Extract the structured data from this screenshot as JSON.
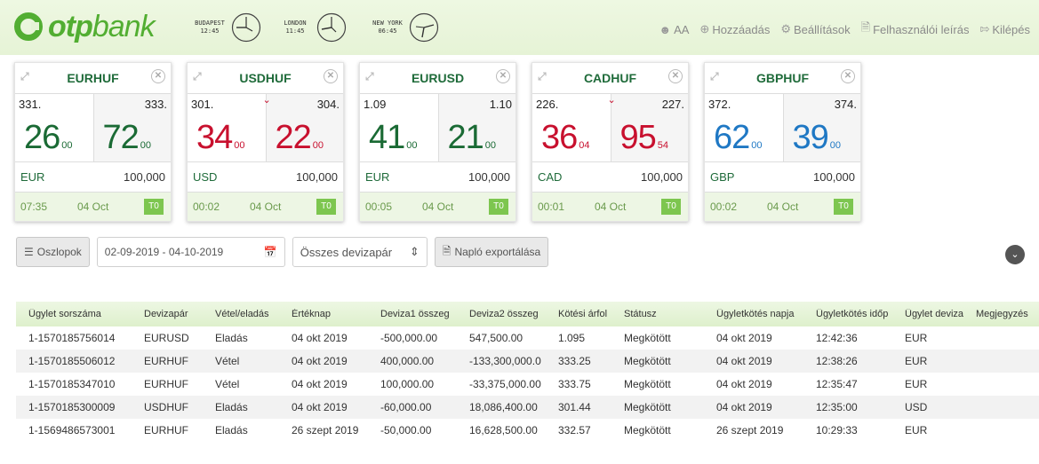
{
  "brand": {
    "otp": "otp",
    "bank": "bank"
  },
  "clocks": [
    {
      "city": "BUDAPEST",
      "time": "12:45"
    },
    {
      "city": "LONDON",
      "time": "11:45"
    },
    {
      "city": "NEW YORK",
      "time": "06:45"
    }
  ],
  "nav": [
    {
      "label": "AA",
      "icon": "user-icon"
    },
    {
      "label": "Hozzáadás",
      "icon": "plus-circle-icon"
    },
    {
      "label": "Beállítások",
      "icon": "gear-icon"
    },
    {
      "label": "Felhasználói leírás",
      "icon": "document-icon"
    },
    {
      "label": "Kilépés",
      "icon": "logout-icon"
    }
  ],
  "tiles": [
    {
      "pair": "EURHUF",
      "sell_small": "331.",
      "sell_big": "26",
      "sell_sub": "00",
      "buy_small": "333.",
      "buy_big": "72",
      "buy_sub": "00",
      "ccy": "EUR",
      "amount": "100,000",
      "time": "07:35",
      "date": "04 Oct",
      "tag": "T0",
      "color": "#1a6a34"
    },
    {
      "pair": "USDHUF",
      "sell_small": "301.",
      "sell_big": "34",
      "sell_sub": "00",
      "buy_small": "304.",
      "buy_big": "22",
      "buy_sub": "00",
      "ccy": "USD",
      "amount": "100,000",
      "time": "00:02",
      "date": "04 Oct",
      "tag": "T0",
      "color": "#c8102e"
    },
    {
      "pair": "EURUSD",
      "sell_small": "1.09",
      "sell_big": "41",
      "sell_sub": "00",
      "buy_small": "1.10",
      "buy_big": "21",
      "buy_sub": "00",
      "ccy": "EUR",
      "amount": "100,000",
      "time": "00:05",
      "date": "04 Oct",
      "tag": "T0",
      "color": "#1a6a34"
    },
    {
      "pair": "CADHUF",
      "sell_small": "226.",
      "sell_big": "36",
      "sell_sub": "04",
      "buy_small": "227.",
      "buy_big": "95",
      "buy_sub": "54",
      "ccy": "CAD",
      "amount": "100,000",
      "time": "00:01",
      "date": "04 Oct",
      "tag": "T0",
      "color": "#c8102e"
    },
    {
      "pair": "GBPHUF",
      "sell_small": "372.",
      "sell_big": "62",
      "sell_sub": "00",
      "buy_small": "374.",
      "buy_big": "39",
      "buy_sub": "00",
      "ccy": "GBP",
      "amount": "100,000",
      "time": "00:02",
      "date": "04 Oct",
      "tag": "T0",
      "color": "#1f78c4"
    }
  ],
  "toolbar": {
    "columns_label": "Oszlopok",
    "date_range": "02-09-2019 - 04-10-2019",
    "pair_select": "Összes devizapár",
    "export_label": "Napló exportálása"
  },
  "table": {
    "headers": [
      "Ügylet sorszáma",
      "Devizapár",
      "Vétel/eladás",
      "Értéknap",
      "Deviza1 összeg",
      "Deviza2 összeg",
      "Kötési árfol",
      "Státusz",
      "Ügyletkötés napja",
      "Ügyletkötés időp",
      "Ügylet deviza",
      "Megjegyzés"
    ],
    "rows": [
      [
        "1-1570185756014",
        "EURUSD",
        "Eladás",
        "04 okt 2019",
        "-500,000.00",
        "547,500.00",
        "1.095",
        "Megkötött",
        "04 okt 2019",
        "12:42:36",
        "EUR",
        ""
      ],
      [
        "1-1570185506012",
        "EURHUF",
        "Vétel",
        "04 okt 2019",
        "400,000.00",
        "-133,300,000.0",
        "333.25",
        "Megkötött",
        "04 okt 2019",
        "12:38:26",
        "EUR",
        ""
      ],
      [
        "1-1570185347010",
        "EURHUF",
        "Vétel",
        "04 okt 2019",
        "100,000.00",
        "-33,375,000.00",
        "333.75",
        "Megkötött",
        "04 okt 2019",
        "12:35:47",
        "EUR",
        ""
      ],
      [
        "1-1570185300009",
        "USDHUF",
        "Eladás",
        "04 okt 2019",
        "-60,000.00",
        "18,086,400.00",
        "301.44",
        "Megkötött",
        "04 okt 2019",
        "12:35:00",
        "USD",
        ""
      ],
      [
        "1-1569486573001",
        "EURHUF",
        "Eladás",
        "26 szept 2019",
        "-50,000.00",
        "16,628,500.00",
        "332.57",
        "Megkötött",
        "26 szept 2019",
        "10:29:33",
        "EUR",
        ""
      ]
    ]
  }
}
